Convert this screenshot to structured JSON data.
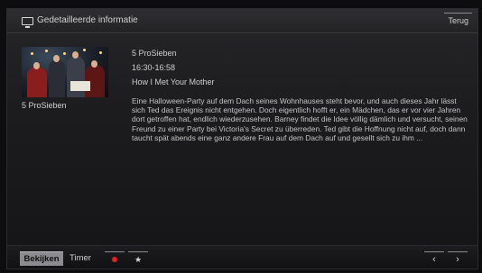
{
  "window": {
    "title": "Gedetailleerde informatie",
    "back_label": "Terug"
  },
  "program": {
    "thumbnail_caption": "5 ProSieben",
    "channel": "5 ProSieben",
    "time": "16:30-16:58",
    "title": "How I Met Your Mother",
    "synopsis": "Eine Halloween-Party auf dem Dach seines Wohnhauses steht bevor, und auch dieses Jahr lässt sich Ted das Ereignis nicht entgehen. Doch eigentlich hofft er, ein Mädchen, das er vor vier Jahren dort getroffen hat, endlich wiederzusehen. Barney findet die Idee völlig dämlich und versucht, seinen Freund zu einer Party bei Victoria's Secret zu überreden. Ted gibt die Hoffnung nicht auf, doch dann taucht spät abends eine ganz andere Frau auf dem Dach auf und gesellt sich zu ihm ..."
  },
  "bottombar": {
    "watch_label": "Bekijken",
    "timer_label": "Timer",
    "record_color": "#e02424",
    "favorite_icon": "star-icon",
    "prev_glyph": "‹",
    "next_glyph": "›"
  }
}
